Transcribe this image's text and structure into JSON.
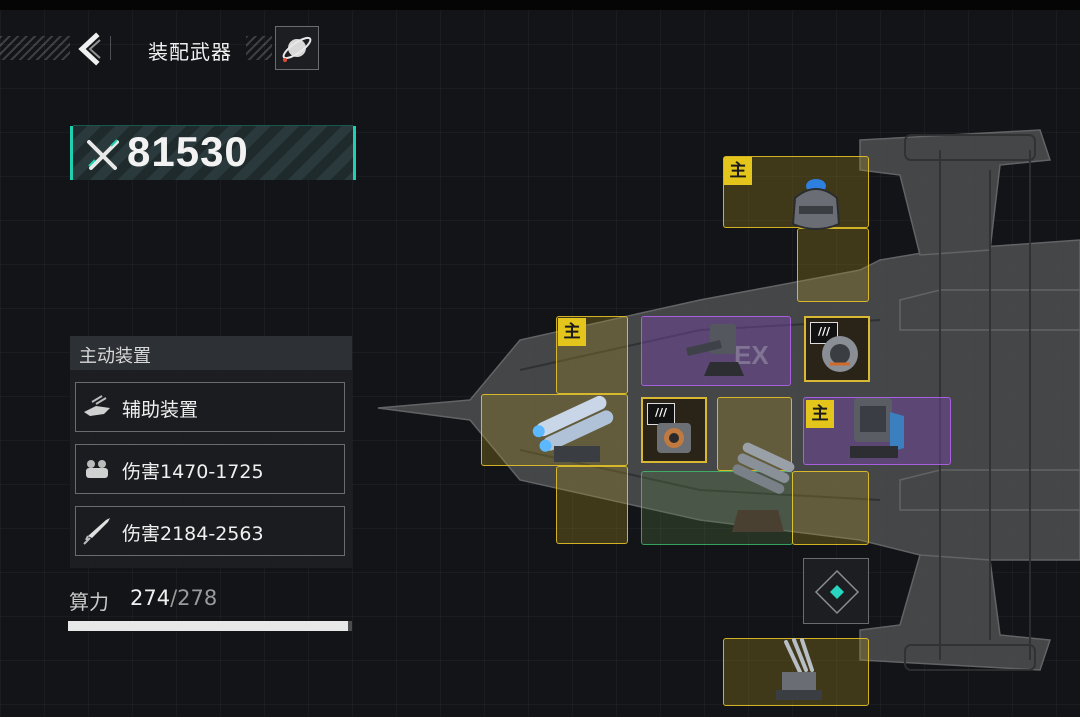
{
  "header": {
    "title": "装配武器",
    "back_icon": "chevron-left-icon",
    "help_icon": "planet-icon"
  },
  "power": {
    "icon": "crossed-swords-icon",
    "value": "81530"
  },
  "active_devices": {
    "title": "主动装置",
    "items": [
      {
        "icon": "support-drone-icon",
        "label": "辅助装置"
      },
      {
        "icon": "turret-icon",
        "label": "伤害1470-1725"
      },
      {
        "icon": "missile-icon",
        "label": "伤害2184-2563"
      }
    ]
  },
  "compute": {
    "label": "算力",
    "current": "274",
    "max": "/278",
    "fill_fraction": 0.9856
  },
  "slots": {
    "main_tag": "主",
    "ex_mark": "EX",
    "chip_badge": "///"
  },
  "colors": {
    "accent_teal": "#1fd1b0",
    "slot_yellow": "#ecc828",
    "slot_purple": "#b464f0",
    "main_tag": "#e3c51b"
  }
}
